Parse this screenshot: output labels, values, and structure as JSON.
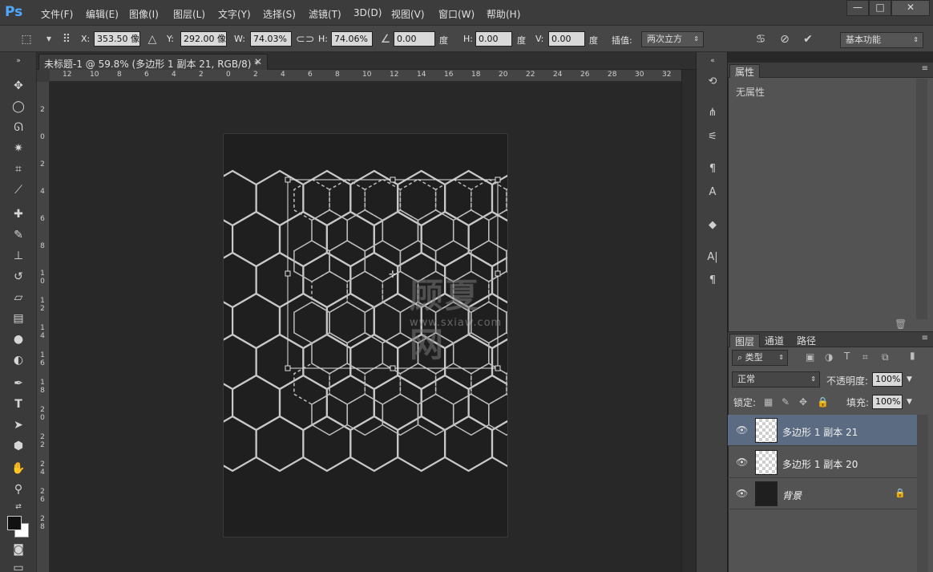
{
  "app": {
    "logo": "Ps"
  },
  "menu": [
    "文件(F)",
    "编辑(E)",
    "图像(I)",
    "图层(L)",
    "文字(Y)",
    "选择(S)",
    "滤镜(T)",
    "3D(D)",
    "视图(V)",
    "窗口(W)",
    "帮助(H)"
  ],
  "window_controls": {
    "minimize": "—",
    "maximize": "□",
    "close": "✕"
  },
  "options": {
    "x_label": "X:",
    "x_value": "353.50 像",
    "y_label": "Y:",
    "y_value": "292.00 像",
    "w_label": "W:",
    "w_value": "74.03%",
    "h_label": "H:",
    "h_value": "74.06%",
    "angle_value": "0.00",
    "angle_unit": "度",
    "hskew_label": "H:",
    "hskew_value": "0.00",
    "hskew_unit": "度",
    "vskew_label": "V:",
    "vskew_value": "0.00",
    "vskew_unit": "度",
    "interp_label": "插值:",
    "interp_value": "两次立方",
    "workspace": "基本功能"
  },
  "document_tab": {
    "title": "未标题-1 @ 59.8% (多边形 1 副本 21, RGB/8) *",
    "close": "✕"
  },
  "rulers": {
    "horizontal": [
      "12",
      "10",
      "8",
      "6",
      "4",
      "2",
      "0",
      "2",
      "4",
      "6",
      "8",
      "10",
      "12",
      "14",
      "16",
      "18",
      "20",
      "22",
      "24",
      "26",
      "28",
      "30",
      "32"
    ],
    "vertical": [
      "2",
      "0",
      "2",
      "4",
      "6",
      "8",
      "10",
      "12",
      "14",
      "16",
      "18",
      "20",
      "22",
      "24",
      "26",
      "28"
    ]
  },
  "watermark": {
    "text": "顾夏网",
    "url": "www.sxiaw.com"
  },
  "properties_panel": {
    "tab": "属性",
    "empty_text": "无属性"
  },
  "layers_panel": {
    "tabs": [
      "图层",
      "通道",
      "路径"
    ],
    "filter_kind": "类型",
    "blend_mode": "正常",
    "opacity_label": "不透明度:",
    "opacity_value": "100%",
    "lock_label": "锁定:",
    "fill_label": "填充:",
    "fill_value": "100%",
    "layers": [
      {
        "name": "多边形 1 副本 21",
        "selected": true
      },
      {
        "name": "多边形 1 副本 20",
        "selected": false
      },
      {
        "name": "背景",
        "selected": false,
        "locked": true
      }
    ]
  }
}
